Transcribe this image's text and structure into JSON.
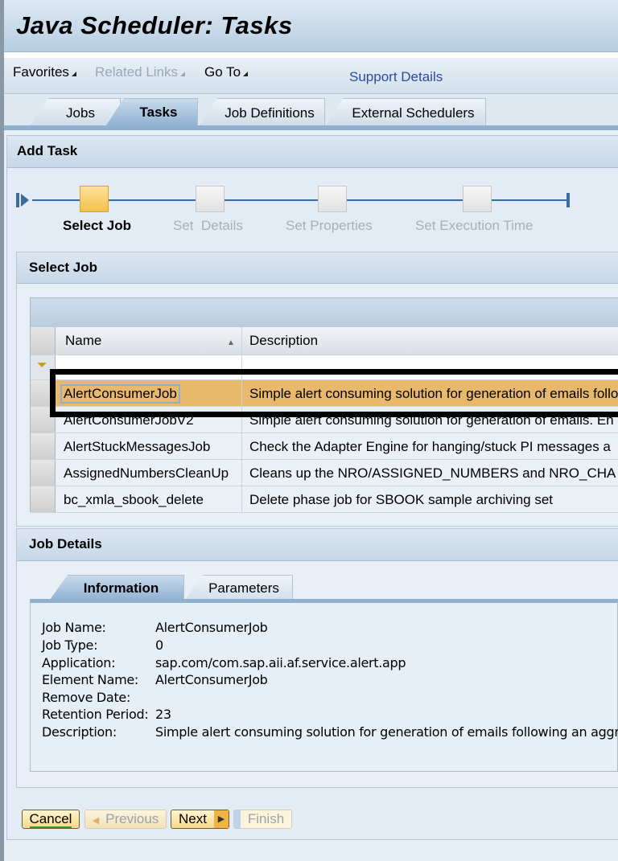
{
  "title": "Java Scheduler: Tasks",
  "menu": {
    "favorites": "Favorites",
    "related_links": "Related Links",
    "go_to": "Go To",
    "support_details": "Support Details"
  },
  "tabs": [
    "Jobs",
    "Tasks",
    "Job Definitions",
    "External Schedulers"
  ],
  "selected_tab": "Tasks",
  "add_task": {
    "title": "Add Task",
    "steps": [
      {
        "label": "Select Job",
        "current": true
      },
      {
        "label": "Set  Details",
        "current": false
      },
      {
        "label": "Set Properties",
        "current": false
      },
      {
        "label": "Set Execution Time",
        "current": false
      }
    ]
  },
  "select_job": {
    "title": "Select Job",
    "columns": [
      "Name",
      "Description"
    ],
    "rows": [
      {
        "name": "AlertConsumerJob",
        "description": "Simple alert consuming solution for generation of emails follo",
        "selected": true
      },
      {
        "name": "AlertConsumerJobV2",
        "description": "Simple alert consuming solution for generation of emails. En"
      },
      {
        "name": "AlertStuckMessagesJob",
        "description": "Check the Adapter Engine for hanging/stuck PI messages a"
      },
      {
        "name": "AssignedNumbersCleanUp",
        "description": "Cleans up the NRO/ASSIGNED_NUMBERS and NRO_CHA"
      },
      {
        "name": "bc_xmla_sbook_delete",
        "description": "Delete phase job for SBOOK sample archiving set"
      }
    ]
  },
  "job_details": {
    "title": "Job Details",
    "tabs": [
      "Information",
      "Parameters"
    ],
    "fields": [
      {
        "label": "Job Name:",
        "value": "AlertConsumerJob"
      },
      {
        "label": "Job Type:",
        "value": "0"
      },
      {
        "label": "Application:",
        "value": "sap.com/com.sap.aii.af.service.alert.app"
      },
      {
        "label": "Element Name:",
        "value": "AlertConsumerJob"
      },
      {
        "label": "Remove Date:",
        "value": ""
      },
      {
        "label": "Retention Period:",
        "value": "23"
      },
      {
        "label": "Description:",
        "value": "Simple alert consuming solution for generation of emails following an aggre"
      }
    ]
  },
  "buttons": {
    "cancel": "Cancel",
    "previous": "Previous",
    "next": "Next",
    "finish": "Finish"
  },
  "colors": {
    "selected_row": "#e8b96a",
    "current_step": "#f4c04a",
    "highlight_box": "#000000"
  }
}
